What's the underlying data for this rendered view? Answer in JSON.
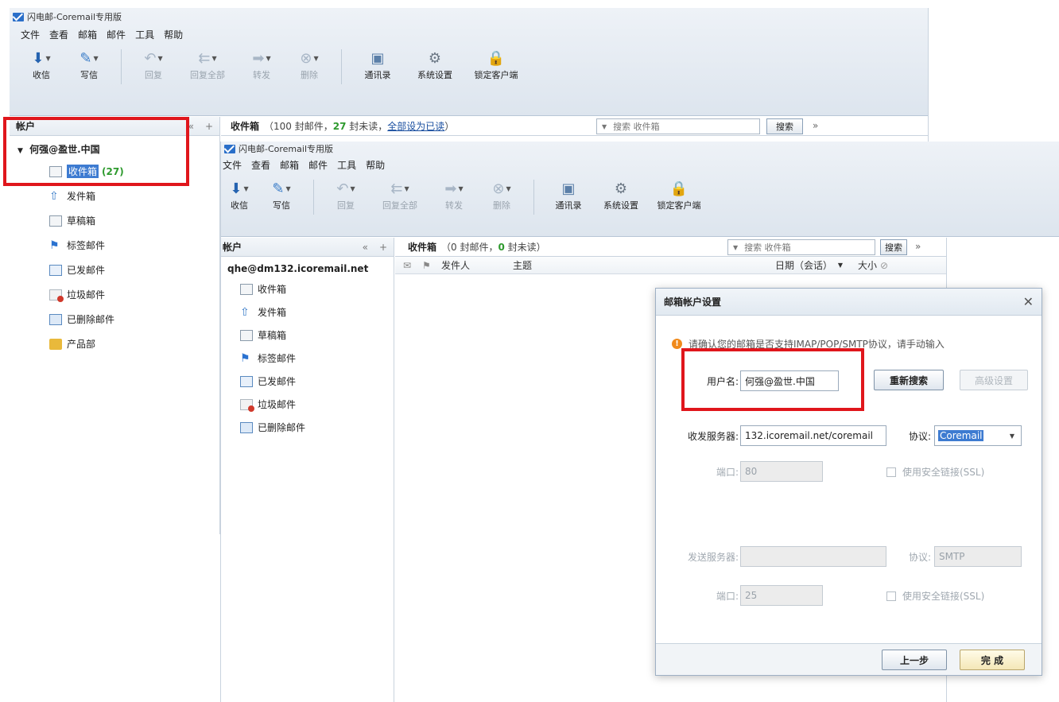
{
  "app": {
    "title": "闪电邮-Coremail专用版"
  },
  "menu": [
    "文件",
    "查看",
    "邮箱",
    "邮件",
    "工具",
    "帮助"
  ],
  "toolbar": {
    "receive": "收信",
    "compose": "写信",
    "reply": "回复",
    "reply_all": "回复全部",
    "forward": "转发",
    "delete": "删除",
    "contacts": "通讯录",
    "settings": "系统设置",
    "lock": "锁定客户端"
  },
  "back_window": {
    "accounts_label": "帐户",
    "account_name": "何强@盈世.中国",
    "inbox_header": {
      "title": "收件箱",
      "meta_prefix": "（100 封邮件，",
      "unread": "27",
      "meta_mid": " 封未读，",
      "mark_all": "全部设为已读",
      "meta_suffix": "）"
    },
    "search_placeholder": "搜索 收件箱",
    "search_button": "搜索",
    "folders": [
      {
        "label": "收件箱",
        "unread": "(27)"
      },
      {
        "label": "发件箱"
      },
      {
        "label": "草稿箱"
      },
      {
        "label": "标签邮件"
      },
      {
        "label": "已发邮件"
      },
      {
        "label": "垃圾邮件"
      },
      {
        "label": "已删除邮件"
      },
      {
        "label": "产品部"
      }
    ]
  },
  "front_window": {
    "accounts_label": "帐户",
    "account_name": "qhe@dm132.icoremail.net",
    "inbox_header": {
      "title": "收件箱",
      "meta_prefix": "（0 封邮件，",
      "unread": "0",
      "meta_suffix": " 封未读）"
    },
    "search_placeholder": "搜索 收件箱",
    "search_button": "搜索",
    "columns": {
      "sender": "发件人",
      "subject": "主题",
      "date": "日期（会话）",
      "size": "大小"
    },
    "folders": [
      {
        "label": "收件箱"
      },
      {
        "label": "发件箱"
      },
      {
        "label": "草稿箱"
      },
      {
        "label": "标签邮件"
      },
      {
        "label": "已发邮件"
      },
      {
        "label": "垃圾邮件"
      },
      {
        "label": "已删除邮件"
      }
    ]
  },
  "dialog": {
    "title": "邮箱帐户设置",
    "notice": "请确认您的邮箱是否支持IMAP/POP/SMTP协议，请手动输入",
    "username_label": "用户名:",
    "username_value": "何强@盈世.中国",
    "research_button": "重新搜索",
    "advanced_button": "高级设置",
    "incoming_label": "收发服务器:",
    "incoming_value": "132.icoremail.net/coremail",
    "protocol_label": "协议:",
    "protocol_value": "Coremail",
    "port_label": "端口:",
    "incoming_port": "80",
    "ssl_label": "使用安全链接(SSL)",
    "outgoing_label": "发送服务器:",
    "outgoing_value": "",
    "outgoing_protocol": "SMTP",
    "outgoing_port": "25",
    "prev_button": "上一步",
    "finish_button": "完 成"
  }
}
